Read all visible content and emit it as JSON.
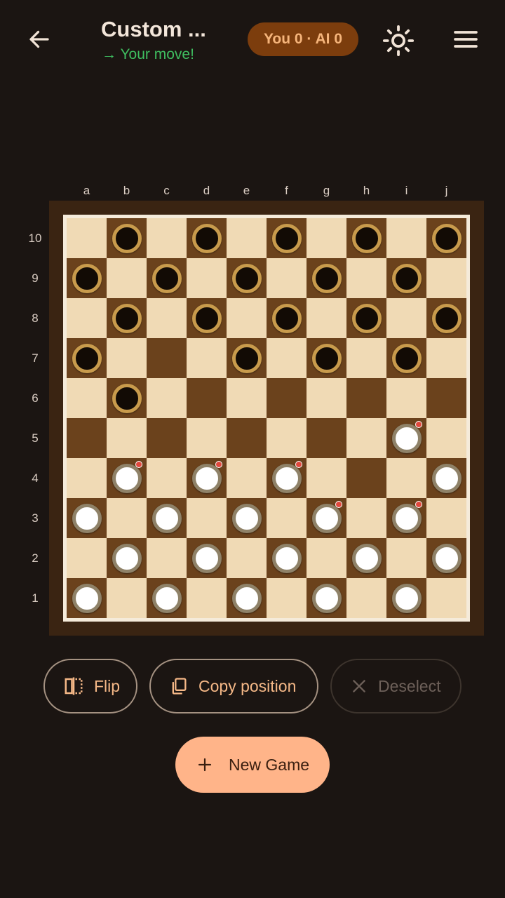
{
  "header": {
    "title": "Custom ...",
    "subtitle": "→ Your move!",
    "score": "You 0 · AI 0"
  },
  "board": {
    "files": [
      "a",
      "b",
      "c",
      "d",
      "e",
      "f",
      "g",
      "h",
      "i",
      "j"
    ],
    "ranks": [
      "10",
      "9",
      "8",
      "7",
      "6",
      "5",
      "4",
      "3",
      "2",
      "1"
    ],
    "rows": [
      [
        null,
        "b",
        null,
        "b",
        null,
        "b",
        null,
        "b",
        null,
        "b"
      ],
      [
        "b",
        null,
        "b",
        null,
        "b",
        null,
        "b",
        null,
        "b",
        null
      ],
      [
        null,
        "b",
        null,
        "b",
        null,
        "b",
        null,
        "b",
        null,
        "b"
      ],
      [
        "b",
        null,
        null,
        null,
        "b",
        null,
        "b",
        null,
        "b",
        null
      ],
      [
        null,
        "b",
        null,
        null,
        null,
        null,
        null,
        null,
        null,
        null
      ],
      [
        null,
        null,
        null,
        null,
        null,
        null,
        null,
        null,
        "w*",
        null
      ],
      [
        null,
        "w*",
        null,
        "w*",
        null,
        "w*",
        null,
        null,
        null,
        "w"
      ],
      [
        "w",
        null,
        "w",
        null,
        "w",
        null,
        "w*",
        null,
        "w*",
        null
      ],
      [
        null,
        "w",
        null,
        "w",
        null,
        "w",
        null,
        "w",
        null,
        "w"
      ],
      [
        "w",
        null,
        "w",
        null,
        "w",
        null,
        "w",
        null,
        "w",
        null
      ]
    ],
    "colors": {
      "light": "#f0dab5",
      "dark": "#6b421c",
      "frame": "#3a2412"
    }
  },
  "actions": {
    "flip_label": "Flip",
    "copy_label": "Copy position",
    "deselect_label": "Deselect",
    "new_game_label": "New Game"
  },
  "icons": {
    "back": "arrow-left-icon",
    "theme": "sun-icon",
    "menu": "hamburger-menu-icon",
    "flip": "flip-icon",
    "copy": "copy-icon",
    "deselect": "close-icon",
    "new_game": "plus-icon"
  },
  "colors": {
    "background": "#1b1512",
    "accent": "#ffb489",
    "score_pill": "#7c3d0d",
    "status_green": "#3fbe60"
  }
}
